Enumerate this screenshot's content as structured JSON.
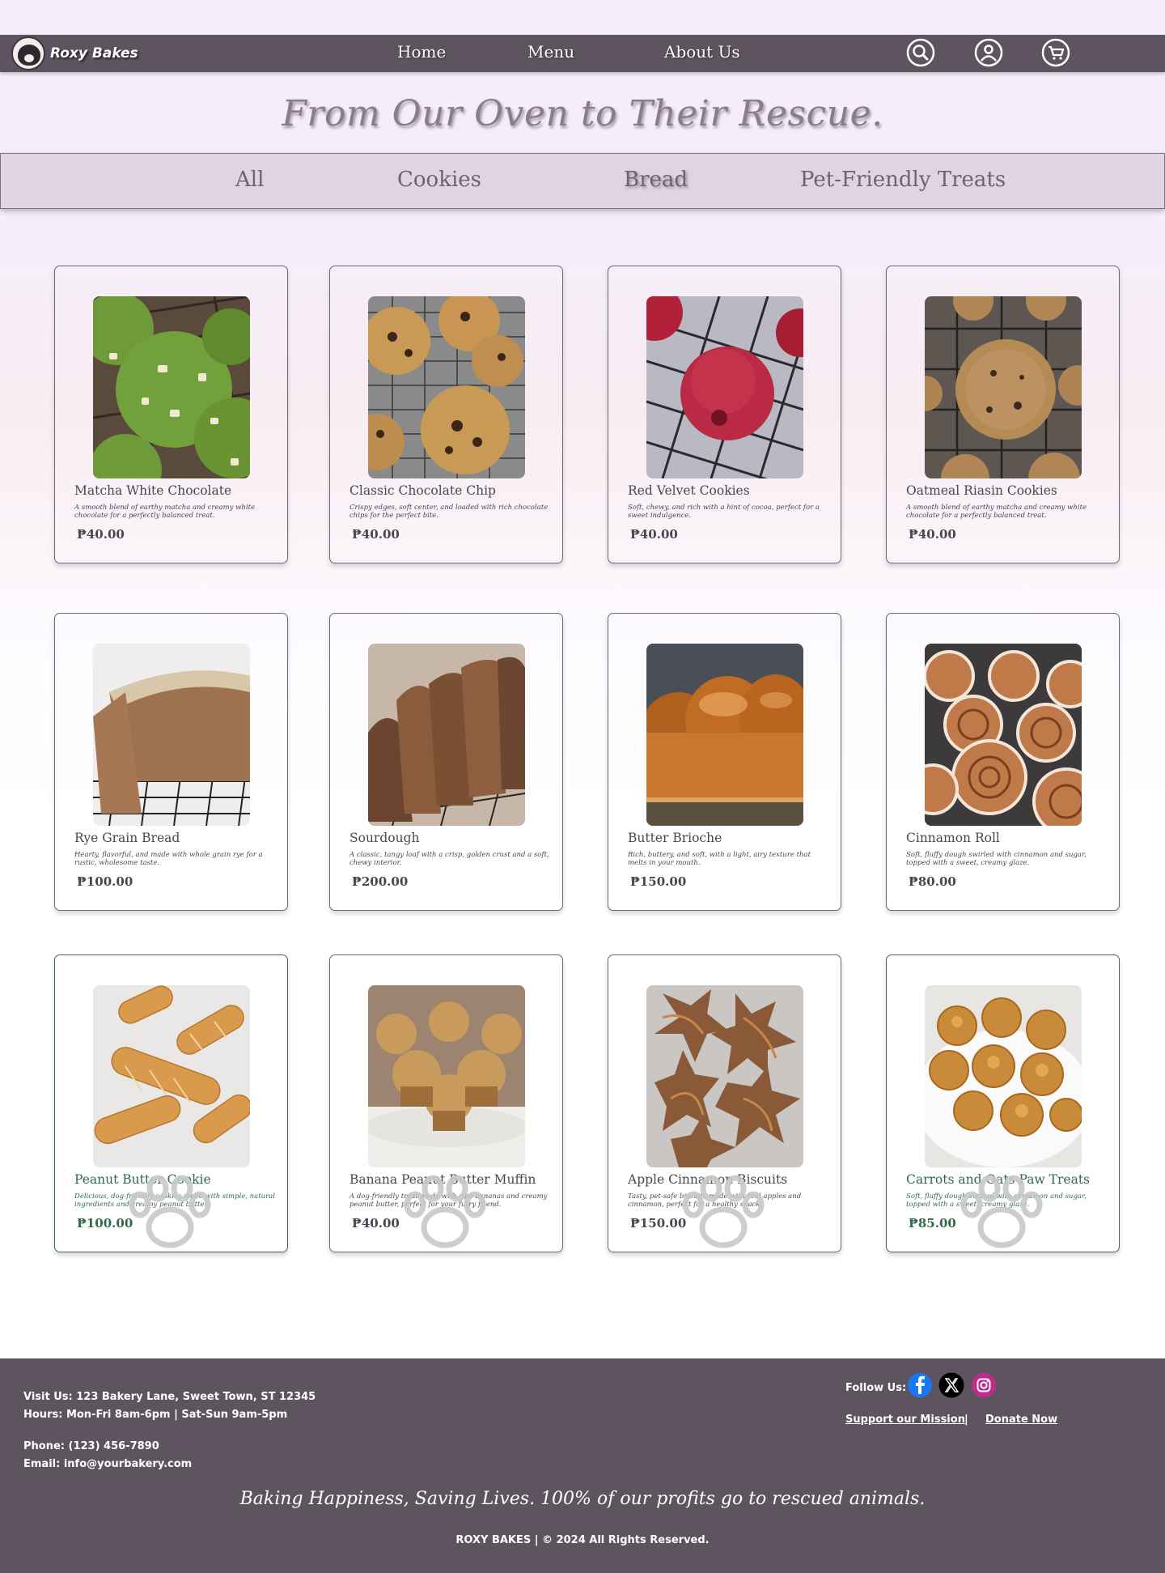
{
  "header": {
    "brand": "Roxy Bakes",
    "nav": [
      {
        "label": "Home"
      },
      {
        "label": "Menu"
      },
      {
        "label": "About Us"
      }
    ],
    "icons": [
      "search-icon",
      "account-icon",
      "cart-icon"
    ]
  },
  "hero": {
    "tagline": "From Our Oven to Their Rescue."
  },
  "categories": [
    "All",
    "Cookies",
    "Bread",
    "Pet-Friendly Treats"
  ],
  "products": [
    {
      "name": "Matcha White Chocolate",
      "desc": "A smooth blend of earthy matcha and creamy white chocolate for a perfectly balanced treat.",
      "price": "₱40.00"
    },
    {
      "name": "Classic Chocolate Chip",
      "desc": "Crispy edges, soft center, and loaded with rich chocolate chips for the perfect bite.",
      "price": "₱40.00"
    },
    {
      "name": "Red Velvet Cookies",
      "desc": "Soft, chewy, and rich with a hint of cocoa, perfect for a sweet indulgence.",
      "price": "₱40.00"
    },
    {
      "name": "Oatmeal Riasin Cookies",
      "desc": "A smooth blend of earthy matcha and creamy white chocolate for a perfectly balanced treat.",
      "price": "₱40.00"
    },
    {
      "name": "Rye Grain Bread",
      "desc": "Hearty, flavorful, and made with whole grain rye for a rustic, wholesome taste.",
      "price": "₱100.00"
    },
    {
      "name": "Sourdough",
      "desc": "A classic, tangy loaf with a crisp, golden crust and a soft, chewy interior.",
      "price": "₱200.00"
    },
    {
      "name": "Butter Brioche",
      "desc": "Rich, buttery, and soft, with a light, airy texture that melts in your mouth.",
      "price": "₱150.00"
    },
    {
      "name": "Cinnamon Roll",
      "desc": "Soft, fluffy dough swirled with cinnamon and sugar, topped with a sweet, creamy glaze.",
      "price": "₱80.00"
    },
    {
      "name": "Peanut Butter Cookie",
      "desc": "Delicious, dog-friendly cookies made with simple, natural ingredients and creamy peanut butter.",
      "price": "₱100.00"
    },
    {
      "name": "Banana Peanut  Butter Muffin",
      "desc": "A dog-friendly treat made with ripe bananas and creamy peanut butter, perfect for your furry friend.",
      "price": "₱40.00"
    },
    {
      "name": "Apple Cinnamon Biscuits",
      "desc": "Tasty, pet-safe biscuits made with real apples and cinnamon, perfect for a healthy snack.",
      "price": "₱150.00"
    },
    {
      "name": "Carrots and Oats Paw Treats",
      "desc": "Soft, fluffy dough swirled with cinnamon and sugar, topped with a sweet, creamy glaze.",
      "price": "₱85.00"
    }
  ],
  "footer": {
    "address": "Visit Us: 123 Bakery Lane, Sweet Town, ST 12345",
    "hours": "Hours: Mon-Fri 8am-6pm | Sat-Sun 9am-5pm",
    "phone": "Phone: (123) 456-7890",
    "email": "Email: info@yourbakery.com",
    "follow": "Follow  Us:",
    "social": [
      "facebook-icon",
      "x-icon",
      "instagram-icon"
    ],
    "support": "Support our Mission",
    "separator": "|",
    "donate": "Donate Now",
    "slogan": "Baking Happiness, Saving Lives. 100% of our profits go to rescued animals.",
    "copyright": "ROXY BAKES   |  © 2024 All Rights Reserved."
  },
  "colors": {
    "nav_bg": "#5e545f",
    "category_bar": "#e2d3e1",
    "pet_accent": "#2f6a4d"
  }
}
